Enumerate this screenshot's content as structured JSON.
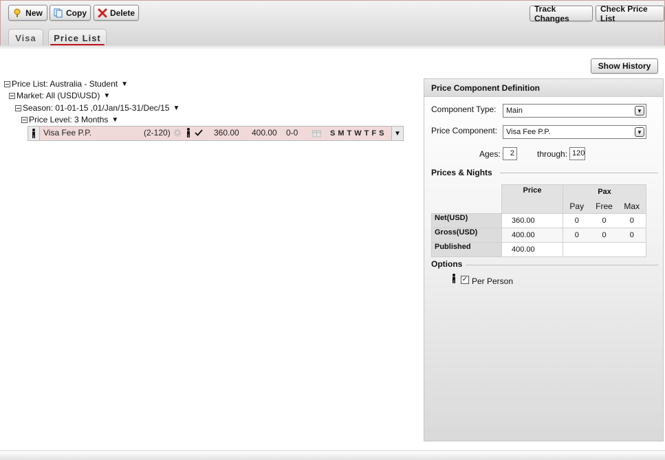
{
  "toolbar": {
    "new_label": "New",
    "copy_label": "Copy",
    "delete_label": "Delete",
    "track_changes_label": "Track Changes",
    "check_price_list_label": "Check Price List"
  },
  "tabs": [
    {
      "label": "Visa",
      "active": false
    },
    {
      "label": "Price List",
      "active": true
    }
  ],
  "tree": {
    "price_list": "Price List: Australia - Student",
    "market": "Market: All (USD\\USD)",
    "season": "Season: 01-01-15 ,01/Jan/15-31/Dec/15",
    "price_level": "Price Level: 3 Months",
    "component": {
      "name": "Visa Fee P.P.",
      "ages": "(2-120)",
      "net": "360.00",
      "gross": "400.00",
      "pax": "0-0",
      "days": [
        "S",
        "M",
        "T",
        "W",
        "T",
        "F",
        "S"
      ]
    }
  },
  "show_history_label": "Show History",
  "panel": {
    "title": "Price Component Definition",
    "component_type_label": "Component Type:",
    "component_type_value": "Main",
    "price_component_label": "Price Component:",
    "price_component_value": "Visa Fee P.P.",
    "ages_label": "Ages:",
    "ages_from": "2",
    "through_label": "through:",
    "ages_to": "120",
    "prices_nights_title": "Prices & Nights",
    "table": {
      "price_header": "Price",
      "pax_header": "Pax",
      "pay_header": "Pay",
      "free_header": "Free",
      "max_header": "Max",
      "rows": [
        {
          "label": "Net(USD)",
          "price": "360.00",
          "pay": "0",
          "free": "0",
          "max": "0"
        },
        {
          "label": "Gross(USD)",
          "price": "400.00",
          "pay": "0",
          "free": "0",
          "max": "0"
        },
        {
          "label": "Published",
          "price": "400.00",
          "pay": "",
          "free": "",
          "max": ""
        }
      ]
    },
    "options_title": "Options",
    "per_person_label": "Per Person",
    "per_person_checked": true
  },
  "colors": {
    "accent_red": "#c0101a",
    "row_highlight": "#f0d9d9"
  }
}
